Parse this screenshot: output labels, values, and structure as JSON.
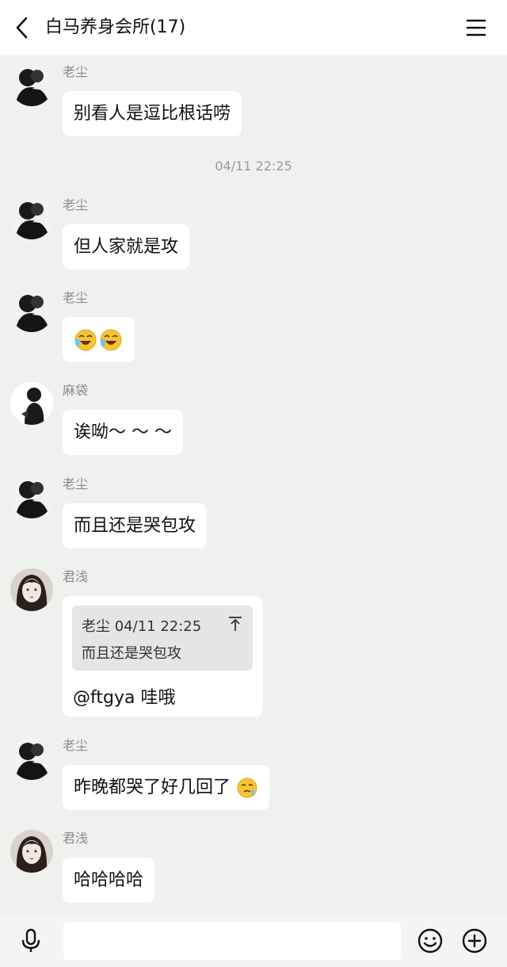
{
  "header": {
    "title": "白马养身会所(17)"
  },
  "timestamp": "04/11 22:25",
  "messages": [
    {
      "sender": "老尘",
      "text": "别看人是逗比根话唠"
    },
    {
      "sender": "老尘",
      "text": "但人家就是攻"
    },
    {
      "sender": "老尘",
      "emoji": "laughing-crying-emoji"
    },
    {
      "sender": "麻袋",
      "text": "诶呦～ ～ ～"
    },
    {
      "sender": "老尘",
      "text": "而且还是哭包攻"
    },
    {
      "sender": "君浅",
      "quote_meta": "老尘 04/11 22:25",
      "quote_text": "而且还是哭包攻",
      "text": "@ftgya 哇哦"
    },
    {
      "sender": "老尘",
      "text": "昨晚都哭了好几回了"
    },
    {
      "sender": "君浅",
      "text": "哈哈哈哈"
    }
  ],
  "input": {
    "placeholder": ""
  },
  "icons": {
    "back": "chevron-left-icon",
    "menu": "menu-icon",
    "mic": "microphone-icon",
    "emoji": "smiley-icon",
    "plus": "plus-circle-icon"
  },
  "colors": {
    "background": "#eef1ee",
    "bubble": "#ffffff",
    "quote": "#e5e5e5"
  }
}
